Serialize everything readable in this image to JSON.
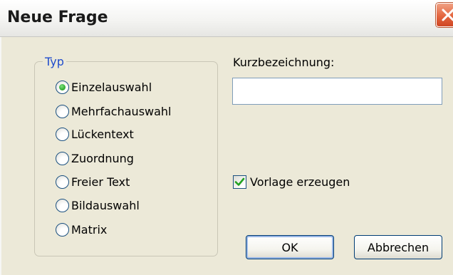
{
  "window": {
    "title": "Neue Frage"
  },
  "typ_group": {
    "legend": "Typ",
    "options": [
      {
        "label": "Einzelauswahl",
        "checked": true
      },
      {
        "label": "Mehrfachauswahl",
        "checked": false
      },
      {
        "label": "Lückentext",
        "checked": false
      },
      {
        "label": "Zuordnung",
        "checked": false
      },
      {
        "label": "Freier Text",
        "checked": false
      },
      {
        "label": "Bildauswahl",
        "checked": false
      },
      {
        "label": "Matrix",
        "checked": false
      }
    ]
  },
  "kurzbezeichnung": {
    "label": "Kurzbezeichnung:",
    "value": ""
  },
  "vorlage": {
    "label": "Vorlage erzeugen",
    "checked": true
  },
  "buttons": {
    "ok": "OK",
    "cancel": "Abbrechen"
  },
  "colors": {
    "legend": "#1f4ccc",
    "dialog_bg": "#ece9d8",
    "close_button": "#e4663f",
    "radio_dot": "#3bb33b"
  },
  "icons": {
    "close": "close-icon",
    "check": "checkmark-icon"
  }
}
